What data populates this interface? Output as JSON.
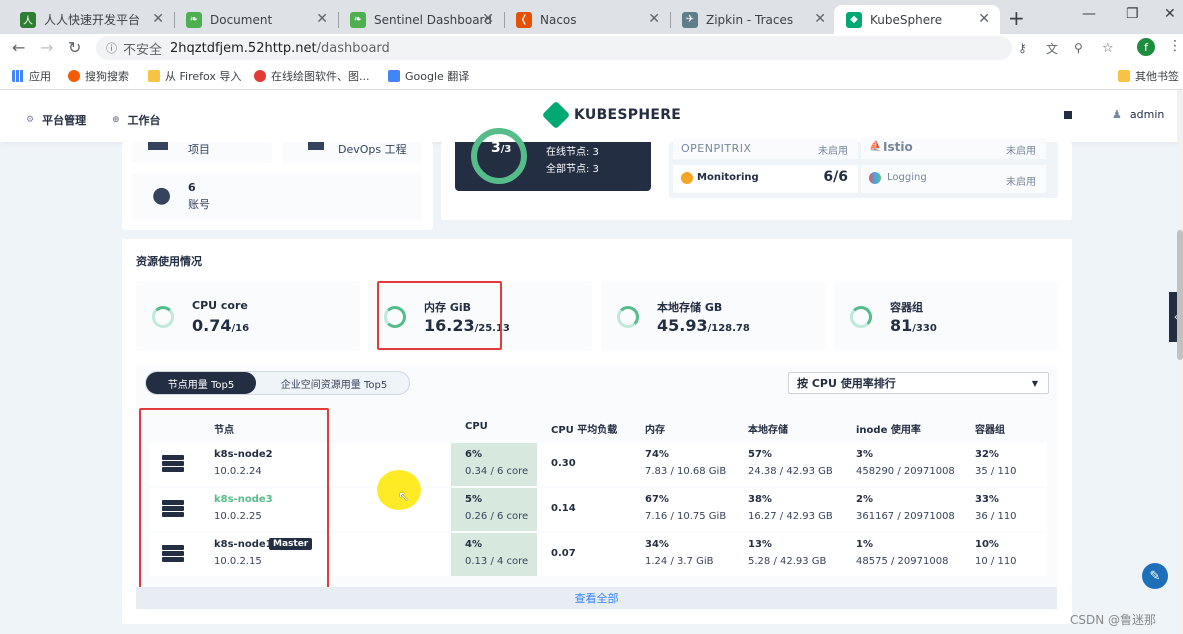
{
  "browser": {
    "tabs": [
      {
        "title": "人人快速开发平台",
        "color": "#2e7d32",
        "glyph": "人"
      },
      {
        "title": "Document",
        "color": "#4caf50",
        "glyph": "❧"
      },
      {
        "title": "Sentinel Dashboard",
        "color": "#4caf50",
        "glyph": "❧"
      },
      {
        "title": "Nacos",
        "color": "#e65100",
        "glyph": "❬"
      },
      {
        "title": "Zipkin - Traces",
        "color": "#607d8b",
        "glyph": "✈"
      },
      {
        "title": "KubeSphere",
        "color": "#00a971",
        "glyph": "◆"
      }
    ],
    "new_tab": "+",
    "address_security": "不安全",
    "address_host": "2hqztdfjem.52http.net",
    "address_path": "/dashboard",
    "profile_initial": "f",
    "bookmarks": [
      "应用",
      "搜狗搜索",
      "从 Firefox 导入",
      "在线绘图软件、图...",
      "Google 翻译"
    ],
    "bookmark_other": "其他书签"
  },
  "header": {
    "nav_platform": "平台管理",
    "nav_workbench": "工作台",
    "logo_text": "KUBESPHERE",
    "user": "admin"
  },
  "overview": {
    "project_label": "项目",
    "devops_label": "DevOps 工程",
    "account_count": "6",
    "account_label": "账号",
    "nodes_ratio": "3",
    "nodes_total": "/3",
    "online_nodes": "在线节点: 3",
    "all_nodes": "全部节点: 3",
    "components": [
      {
        "name": "OPENPITRIX",
        "status": "未启用"
      },
      {
        "name": "Istio",
        "status": "未启用"
      },
      {
        "name": "Monitoring",
        "status": "6/6"
      },
      {
        "name": "Logging",
        "status": "未启用"
      }
    ]
  },
  "resources": {
    "title": "资源使用情况",
    "tiles": [
      {
        "name": "CPU core",
        "value": "0.74",
        "total": "/16",
        "fraction": 0.046
      },
      {
        "name": "内存 GiB",
        "value": "16.23",
        "total": "/25.13",
        "fraction": 0.646
      },
      {
        "name": "本地存储 GB",
        "value": "45.93",
        "total": "/128.78",
        "fraction": 0.357
      },
      {
        "name": "容器组",
        "value": "81",
        "total": "/330",
        "fraction": 0.245
      }
    ],
    "seg_node": "节点用量 Top5",
    "seg_workspace": "企业空间资源用量 Top5",
    "sort_label": "按 CPU 使用率排行",
    "columns": [
      "节点",
      "CPU",
      "CPU 平均负载",
      "内存",
      "本地存储",
      "inode 使用率",
      "容器组"
    ],
    "rows": [
      {
        "name": "k8s-node2",
        "ip": "10.0.2.24",
        "master": "",
        "cpu_pct": "6%",
        "cpu_detail": "0.34 / 6 core",
        "load": "0.30",
        "mem_pct": "74%",
        "mem_detail": "7.83 / 10.68 GiB",
        "disk_pct": "57%",
        "disk_detail": "24.38 / 42.93 GB",
        "inode_pct": "3%",
        "inode_detail": "458290 / 20971008",
        "pod_pct": "32%",
        "pod_detail": "35 / 110"
      },
      {
        "name": "k8s-node3",
        "ip": "10.0.2.25",
        "master": "",
        "cpu_pct": "5%",
        "cpu_detail": "0.26 / 6 core",
        "load": "0.14",
        "mem_pct": "67%",
        "mem_detail": "7.16 / 10.75 GiB",
        "disk_pct": "38%",
        "disk_detail": "16.27 / 42.93 GB",
        "inode_pct": "2%",
        "inode_detail": "361167 / 20971008",
        "pod_pct": "33%",
        "pod_detail": "36 / 110"
      },
      {
        "name": "k8s-node1",
        "ip": "10.0.2.15",
        "master": "Master",
        "cpu_pct": "4%",
        "cpu_detail": "0.13 / 4 core",
        "load": "0.07",
        "mem_pct": "34%",
        "mem_detail": "1.24 / 3.7 GiB",
        "disk_pct": "13%",
        "disk_detail": "5.28 / 42.93 GB",
        "inode_pct": "1%",
        "inode_detail": "48575 / 20971008",
        "pod_pct": "10%",
        "pod_detail": "10 / 110"
      }
    ],
    "view_all": "查看全部"
  },
  "watermark": "CSDN @鲁迷那"
}
